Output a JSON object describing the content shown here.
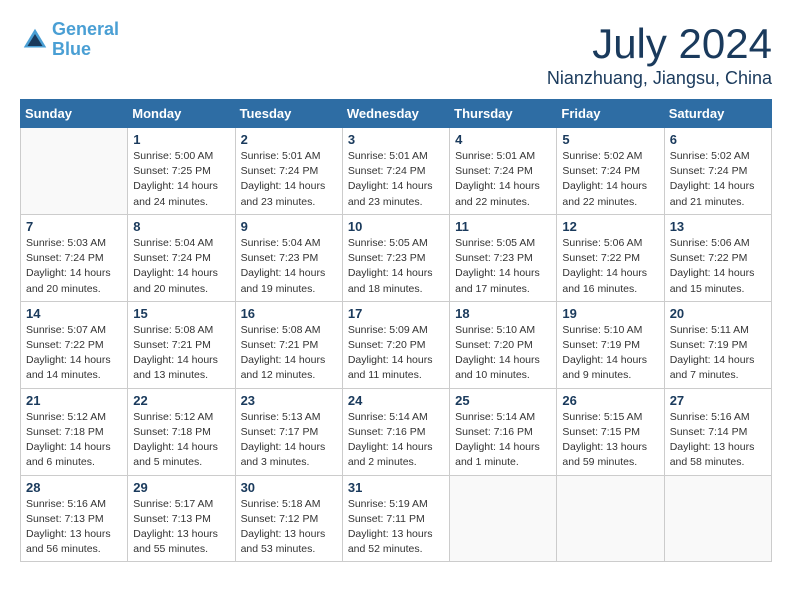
{
  "logo": {
    "line1": "General",
    "line2": "Blue"
  },
  "title": "July 2024",
  "subtitle": "Nianzhuang, Jiangsu, China",
  "days_header": [
    "Sunday",
    "Monday",
    "Tuesday",
    "Wednesday",
    "Thursday",
    "Friday",
    "Saturday"
  ],
  "weeks": [
    [
      {
        "day": "",
        "info": ""
      },
      {
        "day": "1",
        "info": "Sunrise: 5:00 AM\nSunset: 7:25 PM\nDaylight: 14 hours\nand 24 minutes."
      },
      {
        "day": "2",
        "info": "Sunrise: 5:01 AM\nSunset: 7:24 PM\nDaylight: 14 hours\nand 23 minutes."
      },
      {
        "day": "3",
        "info": "Sunrise: 5:01 AM\nSunset: 7:24 PM\nDaylight: 14 hours\nand 23 minutes."
      },
      {
        "day": "4",
        "info": "Sunrise: 5:01 AM\nSunset: 7:24 PM\nDaylight: 14 hours\nand 22 minutes."
      },
      {
        "day": "5",
        "info": "Sunrise: 5:02 AM\nSunset: 7:24 PM\nDaylight: 14 hours\nand 22 minutes."
      },
      {
        "day": "6",
        "info": "Sunrise: 5:02 AM\nSunset: 7:24 PM\nDaylight: 14 hours\nand 21 minutes."
      }
    ],
    [
      {
        "day": "7",
        "info": "Sunrise: 5:03 AM\nSunset: 7:24 PM\nDaylight: 14 hours\nand 20 minutes."
      },
      {
        "day": "8",
        "info": "Sunrise: 5:04 AM\nSunset: 7:24 PM\nDaylight: 14 hours\nand 20 minutes."
      },
      {
        "day": "9",
        "info": "Sunrise: 5:04 AM\nSunset: 7:23 PM\nDaylight: 14 hours\nand 19 minutes."
      },
      {
        "day": "10",
        "info": "Sunrise: 5:05 AM\nSunset: 7:23 PM\nDaylight: 14 hours\nand 18 minutes."
      },
      {
        "day": "11",
        "info": "Sunrise: 5:05 AM\nSunset: 7:23 PM\nDaylight: 14 hours\nand 17 minutes."
      },
      {
        "day": "12",
        "info": "Sunrise: 5:06 AM\nSunset: 7:22 PM\nDaylight: 14 hours\nand 16 minutes."
      },
      {
        "day": "13",
        "info": "Sunrise: 5:06 AM\nSunset: 7:22 PM\nDaylight: 14 hours\nand 15 minutes."
      }
    ],
    [
      {
        "day": "14",
        "info": "Sunrise: 5:07 AM\nSunset: 7:22 PM\nDaylight: 14 hours\nand 14 minutes."
      },
      {
        "day": "15",
        "info": "Sunrise: 5:08 AM\nSunset: 7:21 PM\nDaylight: 14 hours\nand 13 minutes."
      },
      {
        "day": "16",
        "info": "Sunrise: 5:08 AM\nSunset: 7:21 PM\nDaylight: 14 hours\nand 12 minutes."
      },
      {
        "day": "17",
        "info": "Sunrise: 5:09 AM\nSunset: 7:20 PM\nDaylight: 14 hours\nand 11 minutes."
      },
      {
        "day": "18",
        "info": "Sunrise: 5:10 AM\nSunset: 7:20 PM\nDaylight: 14 hours\nand 10 minutes."
      },
      {
        "day": "19",
        "info": "Sunrise: 5:10 AM\nSunset: 7:19 PM\nDaylight: 14 hours\nand 9 minutes."
      },
      {
        "day": "20",
        "info": "Sunrise: 5:11 AM\nSunset: 7:19 PM\nDaylight: 14 hours\nand 7 minutes."
      }
    ],
    [
      {
        "day": "21",
        "info": "Sunrise: 5:12 AM\nSunset: 7:18 PM\nDaylight: 14 hours\nand 6 minutes."
      },
      {
        "day": "22",
        "info": "Sunrise: 5:12 AM\nSunset: 7:18 PM\nDaylight: 14 hours\nand 5 minutes."
      },
      {
        "day": "23",
        "info": "Sunrise: 5:13 AM\nSunset: 7:17 PM\nDaylight: 14 hours\nand 3 minutes."
      },
      {
        "day": "24",
        "info": "Sunrise: 5:14 AM\nSunset: 7:16 PM\nDaylight: 14 hours\nand 2 minutes."
      },
      {
        "day": "25",
        "info": "Sunrise: 5:14 AM\nSunset: 7:16 PM\nDaylight: 14 hours\nand 1 minute."
      },
      {
        "day": "26",
        "info": "Sunrise: 5:15 AM\nSunset: 7:15 PM\nDaylight: 13 hours\nand 59 minutes."
      },
      {
        "day": "27",
        "info": "Sunrise: 5:16 AM\nSunset: 7:14 PM\nDaylight: 13 hours\nand 58 minutes."
      }
    ],
    [
      {
        "day": "28",
        "info": "Sunrise: 5:16 AM\nSunset: 7:13 PM\nDaylight: 13 hours\nand 56 minutes."
      },
      {
        "day": "29",
        "info": "Sunrise: 5:17 AM\nSunset: 7:13 PM\nDaylight: 13 hours\nand 55 minutes."
      },
      {
        "day": "30",
        "info": "Sunrise: 5:18 AM\nSunset: 7:12 PM\nDaylight: 13 hours\nand 53 minutes."
      },
      {
        "day": "31",
        "info": "Sunrise: 5:19 AM\nSunset: 7:11 PM\nDaylight: 13 hours\nand 52 minutes."
      },
      {
        "day": "",
        "info": ""
      },
      {
        "day": "",
        "info": ""
      },
      {
        "day": "",
        "info": ""
      }
    ]
  ]
}
